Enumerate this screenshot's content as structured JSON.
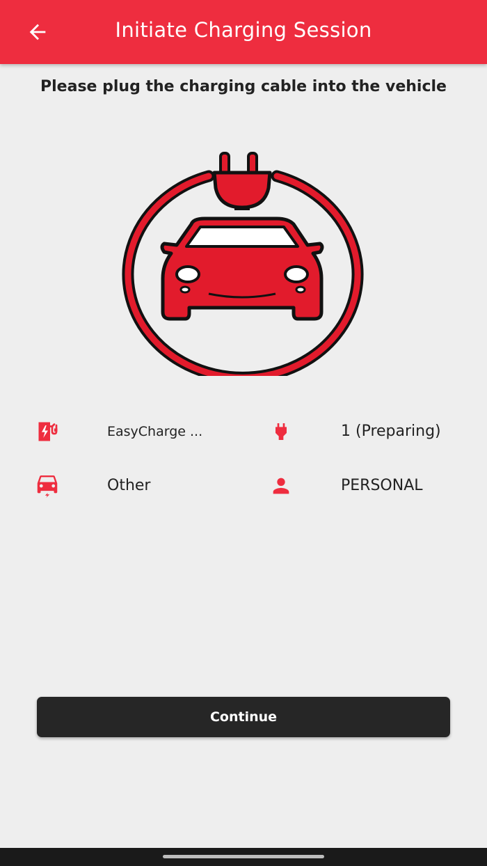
{
  "header": {
    "title": "Initiate Charging Session",
    "back_icon": "arrow-back-icon"
  },
  "instruction": "Please plug the charging cable into the vehicle",
  "illustration": {
    "icon": "plug-car-circle-illustration"
  },
  "details": {
    "station": {
      "icon": "charging-station-icon",
      "label": "EasyCharge ..."
    },
    "connector": {
      "icon": "plug-icon",
      "label": "1 (Preparing)"
    },
    "vehicle": {
      "icon": "electric-car-icon",
      "label": "Other"
    },
    "usage": {
      "icon": "person-icon",
      "label": "PERSONAL"
    }
  },
  "actions": {
    "continue_label": "Continue"
  },
  "colors": {
    "accent": "#ee2d3f",
    "background": "#eeeeee",
    "button": "#262626",
    "text": "#222222"
  }
}
